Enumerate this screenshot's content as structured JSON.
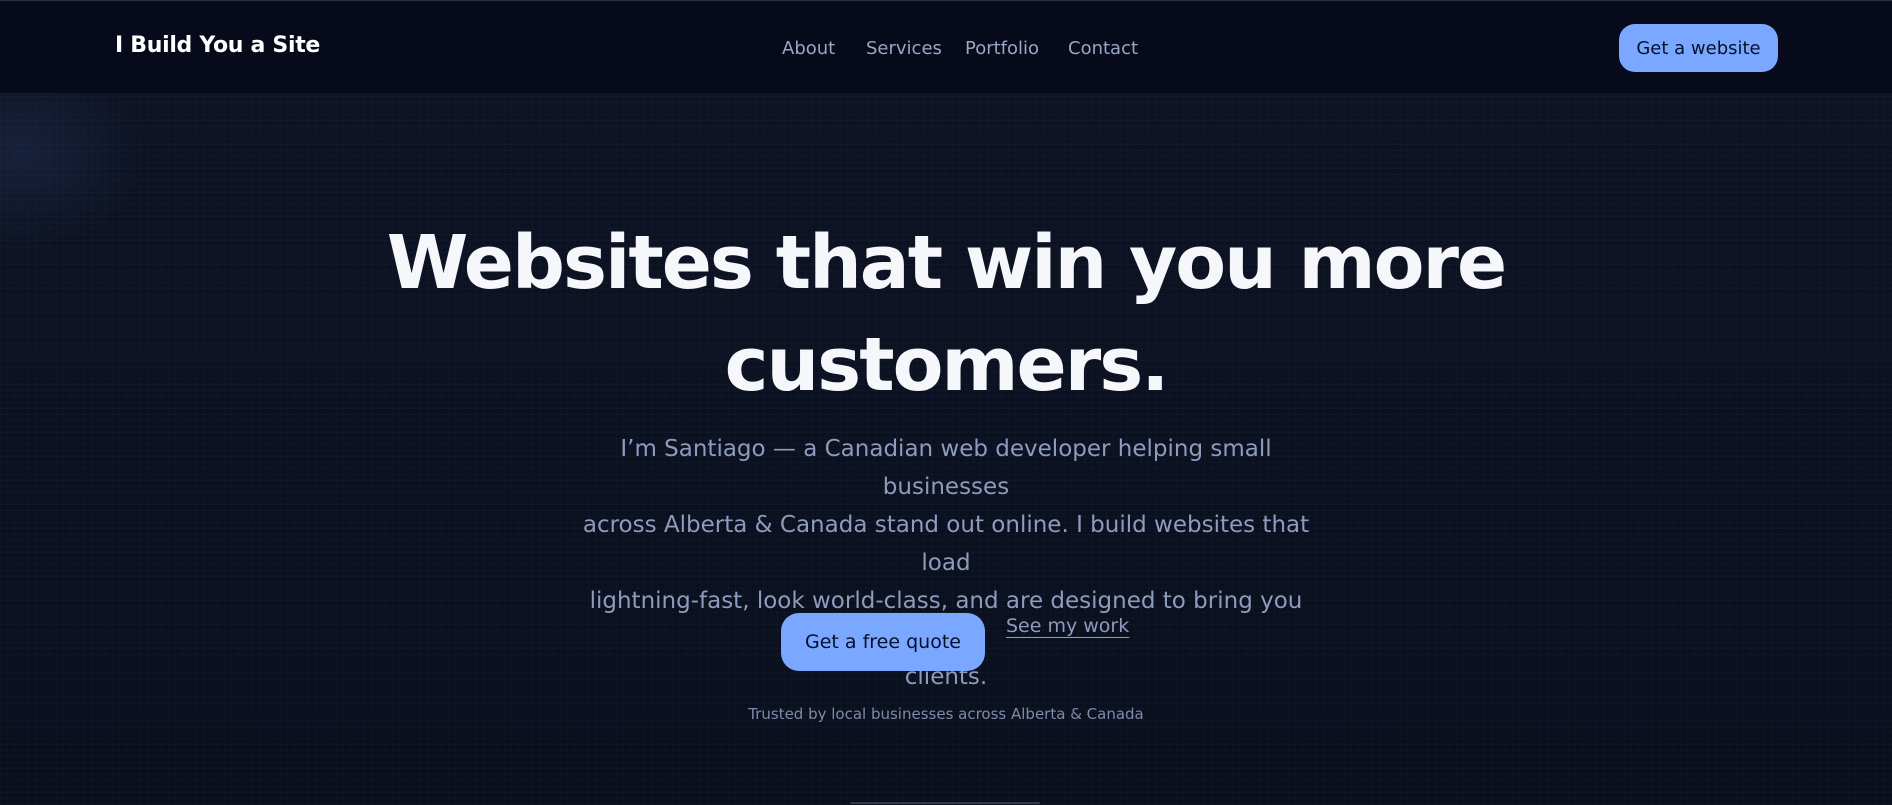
{
  "header": {
    "brand": "I Build You a Site",
    "nav": [
      "About",
      "Services",
      "Portfolio",
      "Contact"
    ],
    "cta_label": "Get a website"
  },
  "hero": {
    "title_line1": "Websites that win you more",
    "title_line2": "customers.",
    "subtitle_line1": "I’m Santiago — a Canadian web developer helping small businesses",
    "subtitle_line2": "across Alberta & Canada stand out online. I build websites that load",
    "subtitle_line3": "lightning-fast, look world-class, and are designed to bring you more",
    "subtitle_line4": "clients.",
    "primary_cta": "Get a free quote",
    "secondary_link": "See my work",
    "trust_line": "Trusted by local businesses across Alberta & Canada"
  },
  "colors": {
    "accent": "#7aa7ff",
    "header_bg": "#060a1b",
    "page_bg": "#0b1020",
    "heading": "#f5f7fb",
    "muted_text": "#8f9bbd"
  }
}
